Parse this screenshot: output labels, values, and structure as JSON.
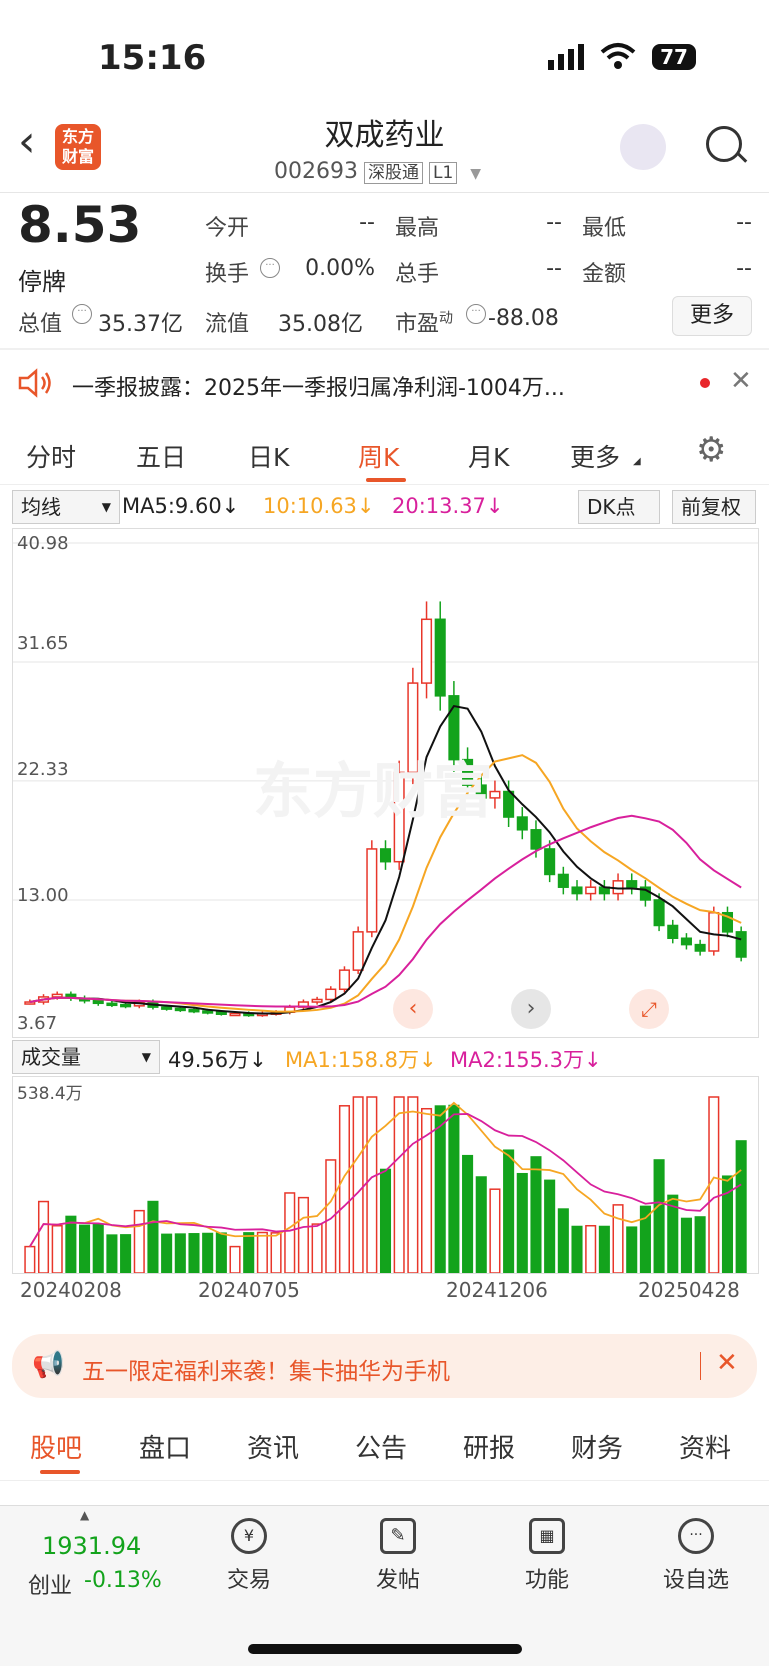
{
  "status": {
    "time": "15:16",
    "battery": "77"
  },
  "header": {
    "back_icon": "‹",
    "logo_text": "东方财富",
    "name": "双成药业",
    "code": "002693",
    "tag1": "深股通",
    "tag2": "L1"
  },
  "quote": {
    "price": "8.53",
    "status": "停牌",
    "open_label": "今开",
    "open": "--",
    "high_label": "最高",
    "high": "--",
    "low_label": "最低",
    "low": "--",
    "turnover_label": "换手",
    "turnover": "0.00%",
    "vol_label": "总手",
    "vol": "--",
    "amount_label": "金额",
    "amount": "--",
    "mktcap_label": "总值",
    "mktcap": "35.37亿",
    "float_label": "流值",
    "float": "35.08亿",
    "pe_label": "市盈",
    "pe_sup": "动",
    "pe": "-88.08",
    "more": "更多"
  },
  "notice": {
    "text": "一季报披露：2025年一季报归属净利润-1004万..."
  },
  "tabs": [
    "分时",
    "五日",
    "日K",
    "周K",
    "月K",
    "更多"
  ],
  "active_tab": 3,
  "chart": {
    "ma_select": "均线",
    "ma5": "MA5:9.60↓",
    "ma10": "10:10.63↓",
    "ma20": "20:13.37↓",
    "dk": "DK点",
    "fq": "前复权",
    "y_labels": [
      "40.98",
      "31.65",
      "22.33",
      "13.00",
      "3.67"
    ],
    "watermark": "东方财富",
    "vol_select": "成交量",
    "vol_val": "49.56万↓",
    "vol_ma1": "MA1:158.8万↓",
    "vol_ma2": "MA2:155.3万↓",
    "vol_max": "538.4万",
    "dates": [
      "20240208",
      "20240705",
      "20241206",
      "20250428"
    ],
    "colors": {
      "up": "#e8362a",
      "down": "#13a31c",
      "ma5": "#111111",
      "ma10": "#f6a623",
      "ma20": "#d8209c"
    }
  },
  "chart_data": {
    "type": "candlestick",
    "yrange": [
      3.67,
      40.98
    ],
    "close_approx": [
      5.0,
      5.4,
      5.6,
      5.3,
      5.1,
      4.9,
      4.8,
      4.7,
      5.0,
      4.6,
      4.5,
      4.4,
      4.3,
      4.2,
      4.1,
      4.1,
      4.0,
      4.1,
      4.2,
      4.6,
      5.0,
      5.2,
      6.0,
      7.5,
      10.5,
      17.0,
      16.0,
      23.0,
      30.0,
      35.0,
      29.0,
      24.0,
      22.0,
      21.0,
      21.5,
      19.5,
      18.5,
      17.0,
      15.0,
      14.0,
      13.5,
      14.0,
      13.5,
      14.5,
      14.0,
      13.0,
      11.0,
      10.0,
      9.5,
      9.0,
      12.0,
      10.5,
      8.53
    ],
    "ma5": "9.60",
    "ma10": "10.63",
    "ma20": "13.37"
  },
  "banner": {
    "text": "五一限定福利来袭！集卡抽华为手机"
  },
  "bottom_tabs": [
    "股吧",
    "盘口",
    "资讯",
    "公告",
    "研报",
    "财务",
    "资料"
  ],
  "index": {
    "value": "1931.94",
    "name": "创业",
    "change": "-0.13%"
  },
  "nav": [
    "交易",
    "发帖",
    "功能",
    "设自选"
  ]
}
